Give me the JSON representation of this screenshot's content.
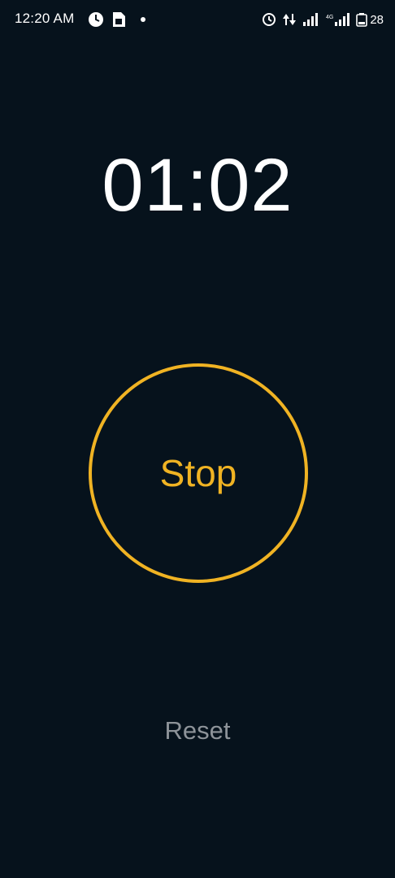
{
  "status_bar": {
    "time": "12:20 AM",
    "battery": "28"
  },
  "stopwatch": {
    "elapsed": "01:02",
    "stop_label": "Stop",
    "reset_label": "Reset"
  },
  "colors": {
    "background": "#06121c",
    "accent": "#f0b323",
    "text_primary": "#ffffff",
    "text_secondary": "#8d9399"
  },
  "icons": [
    "clock-icon",
    "sim-card-icon",
    "dot-icon",
    "alarm-icon",
    "data-transfer-icon",
    "signal-icon",
    "wifi-signal-icon",
    "battery-icon"
  ]
}
